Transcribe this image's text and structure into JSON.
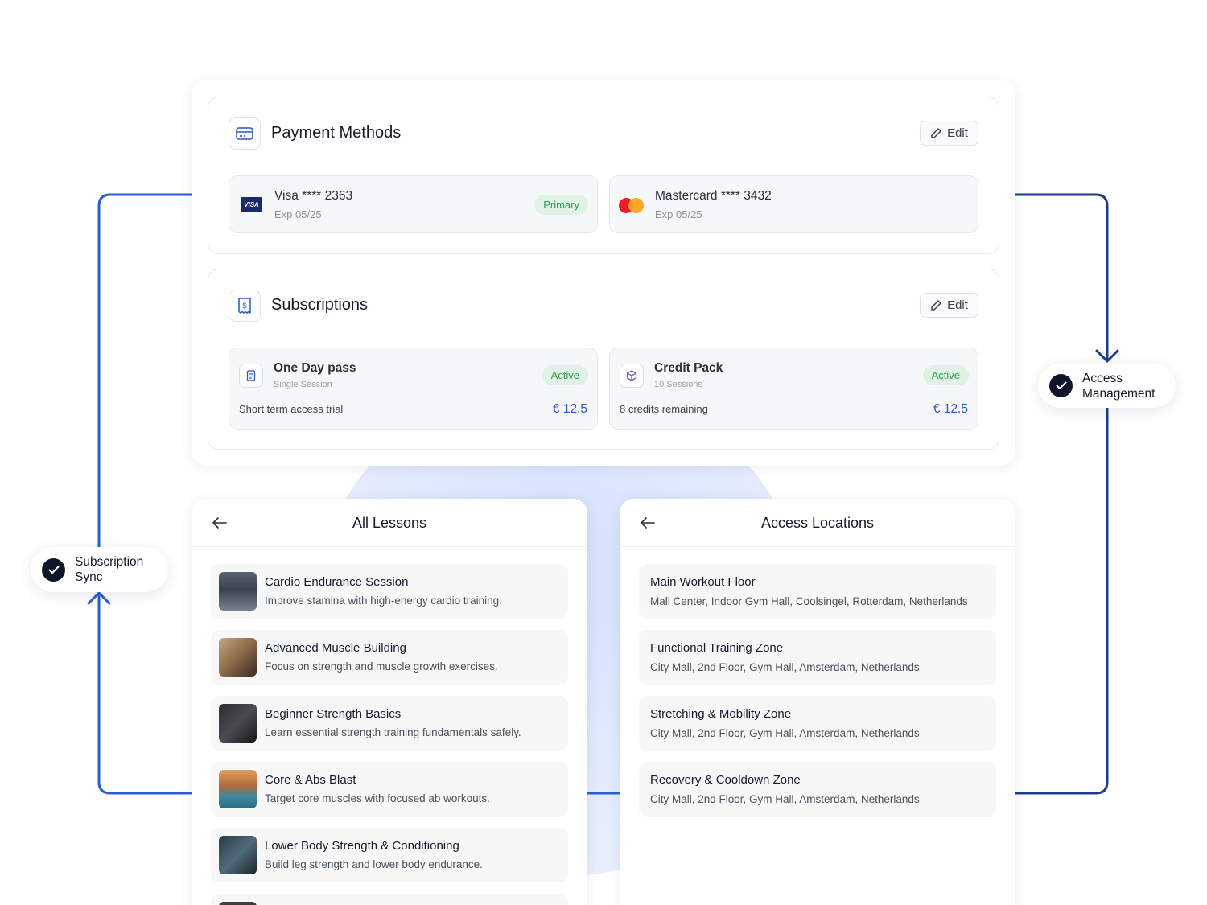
{
  "flow": {
    "subscription_sync": "Subscription\nSync",
    "access_management": "Access\nManagement"
  },
  "payment": {
    "title": "Payment Methods",
    "edit_label": "Edit",
    "cards": [
      {
        "name": "Visa **** 2363",
        "exp": "Exp 05/25",
        "badge": "Primary",
        "brand": "VISA"
      },
      {
        "name": "Mastercard **** 3432",
        "exp": "Exp 05/25"
      }
    ]
  },
  "subscriptions": {
    "title": "Subscriptions",
    "edit_label": "Edit",
    "items": [
      {
        "name": "One Day pass",
        "type": "Single Session",
        "status": "Active",
        "desc": "Short term access trial",
        "price": "€ 12.5"
      },
      {
        "name": "Credit Pack",
        "type": "10 Sessions",
        "status": "Active",
        "desc": "8 credits remaining",
        "price": "€ 12.5"
      }
    ]
  },
  "lessons": {
    "title": "All Lessons",
    "items": [
      {
        "title": "Cardio Endurance Session",
        "desc": "Improve stamina with high-energy cardio training."
      },
      {
        "title": "Advanced Muscle Building",
        "desc": "Focus on strength and muscle growth exercises."
      },
      {
        "title": "Beginner Strength Basics",
        "desc": "Learn essential strength training fundamentals safely."
      },
      {
        "title": "Core & Abs Blast",
        "desc": "Target core muscles with focused ab workouts."
      },
      {
        "title": "Lower Body Strength & Conditioning",
        "desc": "Build leg strength and lower body endurance."
      }
    ]
  },
  "locations": {
    "title": "Access Locations",
    "items": [
      {
        "title": "Main Workout Floor",
        "address": "Mall Center, Indoor Gym Hall, Coolsingel, Rotterdam, Netherlands"
      },
      {
        "title": "Functional Training Zone",
        "address": "City Mall, 2nd Floor, Gym Hall, Amsterdam, Netherlands"
      },
      {
        "title": "Stretching & Mobility Zone",
        "address": "City Mall, 2nd Floor, Gym Hall, Amsterdam, Netherlands"
      },
      {
        "title": "Recovery & Cooldown Zone",
        "address": "City Mall, 2nd Floor, Gym Hall, Amsterdam, Netherlands"
      }
    ]
  },
  "colors": {
    "accent_blue": "#2757c9",
    "connector_left": "#2a5fd1",
    "connector_right": "#1d3c8f",
    "badge_green": "#2e9a52"
  }
}
